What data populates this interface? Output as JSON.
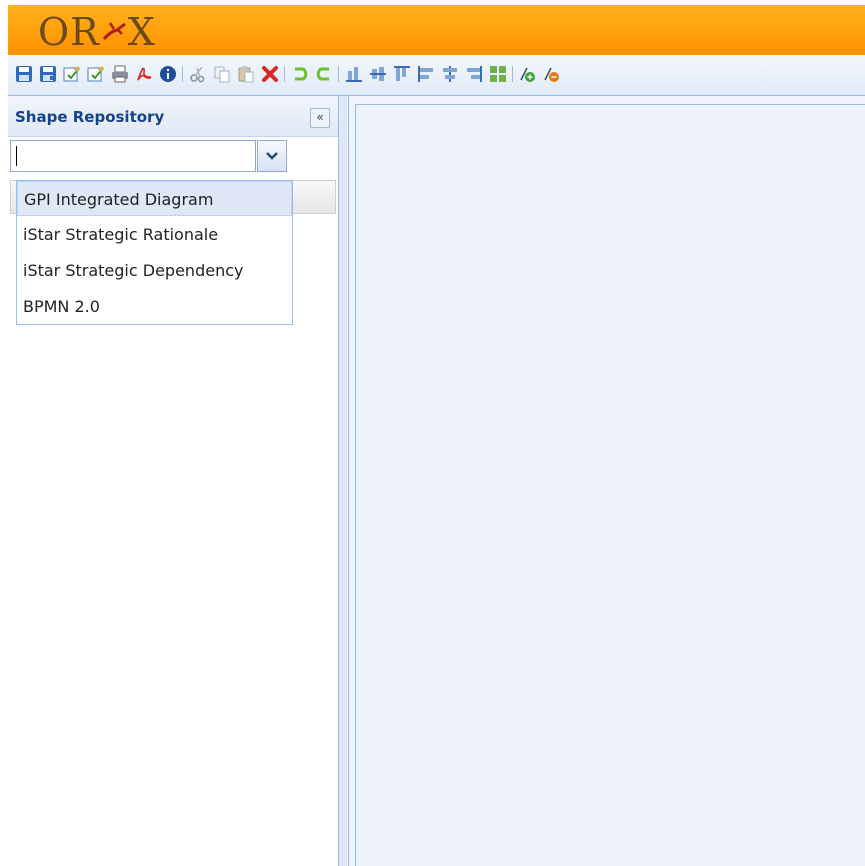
{
  "app": {
    "logo_text_left": "OR",
    "logo_text_right": "X"
  },
  "toolbar": {
    "buttons": [
      {
        "icon": "save-icon"
      },
      {
        "icon": "save-as-icon"
      },
      {
        "icon": "edit-properties-icon"
      },
      {
        "icon": "edit-properties-alt-icon"
      },
      {
        "icon": "print-icon"
      },
      {
        "icon": "pdf-export-icon"
      },
      {
        "icon": "info-icon"
      },
      {
        "icon": "cut-icon"
      },
      {
        "icon": "copy-icon"
      },
      {
        "icon": "paste-icon"
      },
      {
        "icon": "delete-icon"
      },
      {
        "icon": "undo-icon"
      },
      {
        "icon": "redo-icon"
      },
      {
        "icon": "align-bottom-icon"
      },
      {
        "icon": "align-middle-icon"
      },
      {
        "icon": "align-top-icon"
      },
      {
        "icon": "align-left-icon"
      },
      {
        "icon": "align-center-icon"
      },
      {
        "icon": "align-right-icon"
      },
      {
        "icon": "same-size-icon"
      },
      {
        "icon": "add-docker-icon"
      },
      {
        "icon": "remove-docker-icon"
      }
    ]
  },
  "west_panel": {
    "title": "Shape Repository",
    "collapse_label": "«",
    "combo": {
      "value": "",
      "options": [
        "GPI Integrated Diagram",
        "iStar Strategic Rationale",
        "iStar Strategic Dependency",
        "BPMN 2.0"
      ],
      "highlighted_index": 0
    }
  },
  "colors": {
    "header_orange": "#ffa00a",
    "toolbar_blue": "#dfe8f6",
    "panel_title": "#15428b",
    "canvas_bg": "#edf1fb"
  }
}
